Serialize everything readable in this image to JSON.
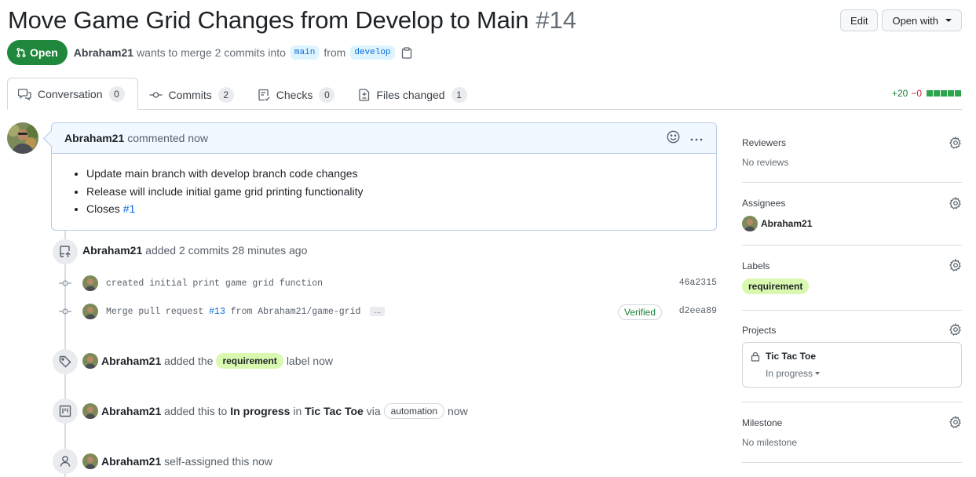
{
  "header": {
    "title": "Move Game Grid Changes from Develop to Main",
    "number": "#14",
    "edit_label": "Edit",
    "open_with_label": "Open with",
    "state": "Open",
    "author": "Abraham21",
    "merge_text": "wants to merge 2 commits into",
    "base_branch": "main",
    "from_text": "from",
    "head_branch": "develop"
  },
  "tabs": [
    {
      "label": "Conversation",
      "count": "0",
      "icon": "comment-discussion-icon",
      "active": true
    },
    {
      "label": "Commits",
      "count": "2",
      "icon": "git-commit-icon"
    },
    {
      "label": "Checks",
      "count": "0",
      "icon": "checklist-icon"
    },
    {
      "label": "Files changed",
      "count": "1",
      "icon": "file-diff-icon"
    }
  ],
  "diffstat": {
    "additions": "+20",
    "deletions": "−0",
    "blocks": 5
  },
  "comment": {
    "author": "Abraham21",
    "action": "commented now",
    "items": [
      "Update main branch with develop branch code changes",
      "Release will include initial game grid printing functionality"
    ],
    "closes_text": "Closes",
    "closes_ref": "#1"
  },
  "timeline": {
    "commits_event": {
      "author": "Abraham21",
      "text": "added 2 commits 28 minutes ago"
    },
    "commits": [
      {
        "message": "created initial print game grid function",
        "sha": "46a2315",
        "verified": false
      },
      {
        "message_pre": "Merge pull request",
        "ref": "#13",
        "message_post": "from Abraham21/game-grid",
        "sha": "d2eea89",
        "verified": true,
        "verified_label": "Verified"
      }
    ],
    "label_event": {
      "author": "Abraham21",
      "pre": "added the",
      "label": "requirement",
      "post": "label now"
    },
    "project_event": {
      "author": "Abraham21",
      "pre": "added this to",
      "column": "In progress",
      "mid": "in",
      "project": "Tic Tac Toe",
      "via": "via",
      "automation": "automation",
      "post": "now"
    },
    "assign_event": {
      "author": "Abraham21",
      "text": "self-assigned this now"
    }
  },
  "sidebar": {
    "reviewers": {
      "title": "Reviewers",
      "value": "No reviews"
    },
    "assignees": {
      "title": "Assignees",
      "user": "Abraham21"
    },
    "labels": {
      "title": "Labels",
      "label": "requirement",
      "color": "#d9f9b0"
    },
    "projects": {
      "title": "Projects",
      "name": "Tic Tac Toe",
      "column": "In progress"
    },
    "milestone": {
      "title": "Milestone",
      "value": "No milestone"
    }
  },
  "colors": {
    "open_green": "#1f883d",
    "link_blue": "#0969da",
    "add_green": "#1a7f37",
    "del_red": "#cf222e"
  }
}
